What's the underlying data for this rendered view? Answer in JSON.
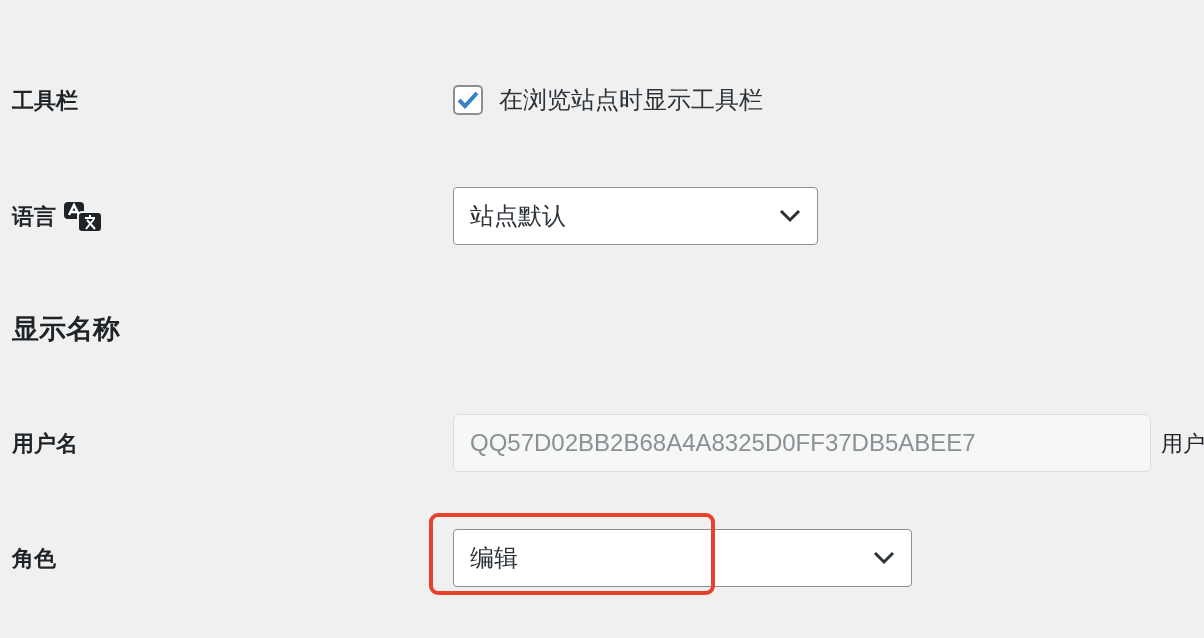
{
  "rows": [
    {
      "kind": "checkbox",
      "label": "工具栏",
      "text": "在浏览站点时显示工具栏",
      "checked": true
    },
    {
      "kind": "select",
      "label": "语言",
      "label_icon": true,
      "value": "站点默认",
      "wide": false
    },
    {
      "kind": "heading",
      "label": "显示名称"
    },
    {
      "kind": "readonly",
      "label": "用户名",
      "value": "QQ57D02BB2B68A4A8325D0FF37DB5ABEE7",
      "note": "用户"
    },
    {
      "kind": "select",
      "label": "角色",
      "value": "编辑",
      "wide": true,
      "highlighted": true
    }
  ]
}
